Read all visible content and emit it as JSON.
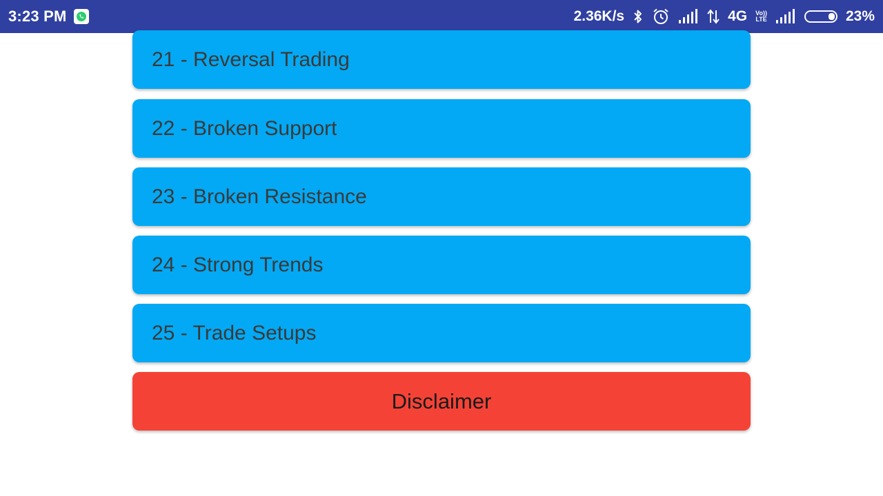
{
  "status_bar": {
    "time": "3:23 PM",
    "notification_icon": "whatsapp-icon",
    "network_speed": "2.36K/s",
    "network_type": "4G",
    "volte_label_top": "Vo))",
    "volte_label_bottom": "LTE",
    "battery_percent": "23%",
    "battery_level": 0.23,
    "icons": [
      "bluetooth-icon",
      "alarm-icon",
      "signal-icon",
      "data-arrows-icon",
      "volte-icon",
      "signal-icon",
      "battery-icon"
    ],
    "background_color": "#3040a0"
  },
  "menu": {
    "items": [
      {
        "label": "21 - Reversal Trading"
      },
      {
        "label": "22 - Broken Support"
      },
      {
        "label": "23 - Broken Resistance"
      },
      {
        "label": "24 - Strong Trends"
      },
      {
        "label": "25 - Trade Setups"
      }
    ],
    "item_color": "#03a9f4",
    "disclaimer_label": "Disclaimer",
    "disclaimer_color": "#f44336"
  }
}
